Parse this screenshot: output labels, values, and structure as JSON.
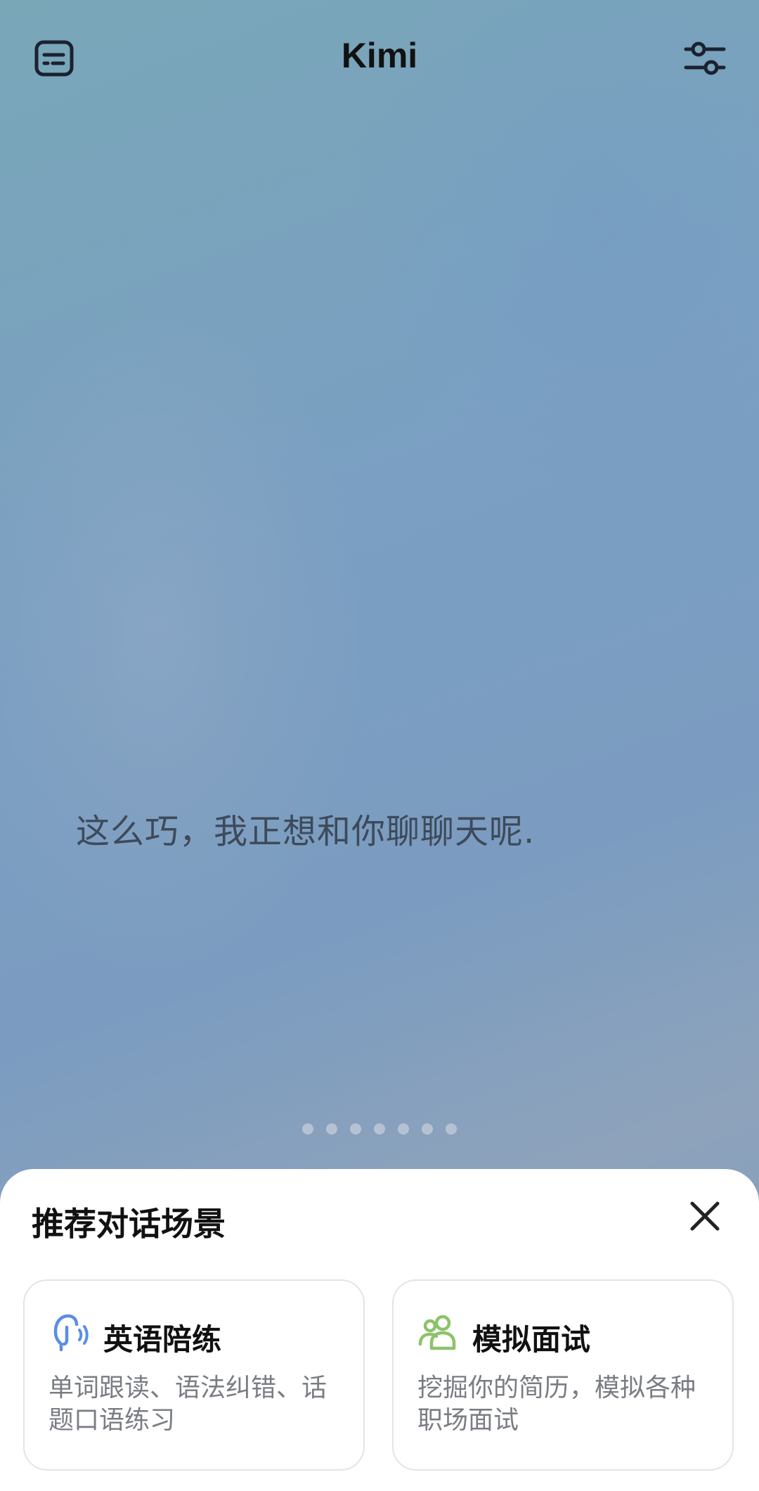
{
  "header": {
    "title": "Kimi",
    "left_icon": "subtitles-icon",
    "right_icon": "settings-sliders-icon"
  },
  "main": {
    "message": "这么巧，我正想和你聊聊天呢.",
    "page_indicator": {
      "count": 7
    }
  },
  "sheet": {
    "title": "推荐对话场景",
    "close_icon": "close-icon",
    "cards": [
      {
        "title": "英语陪练",
        "description": "单词跟读、语法纠错、话题口语练习",
        "icon": "speaking-head-icon",
        "icon_color": "#5b8de6"
      },
      {
        "title": "模拟面试",
        "description": "挖掘你的简历，模拟各种职场面试",
        "icon": "people-icon",
        "icon_color": "#8cc36a"
      }
    ]
  }
}
